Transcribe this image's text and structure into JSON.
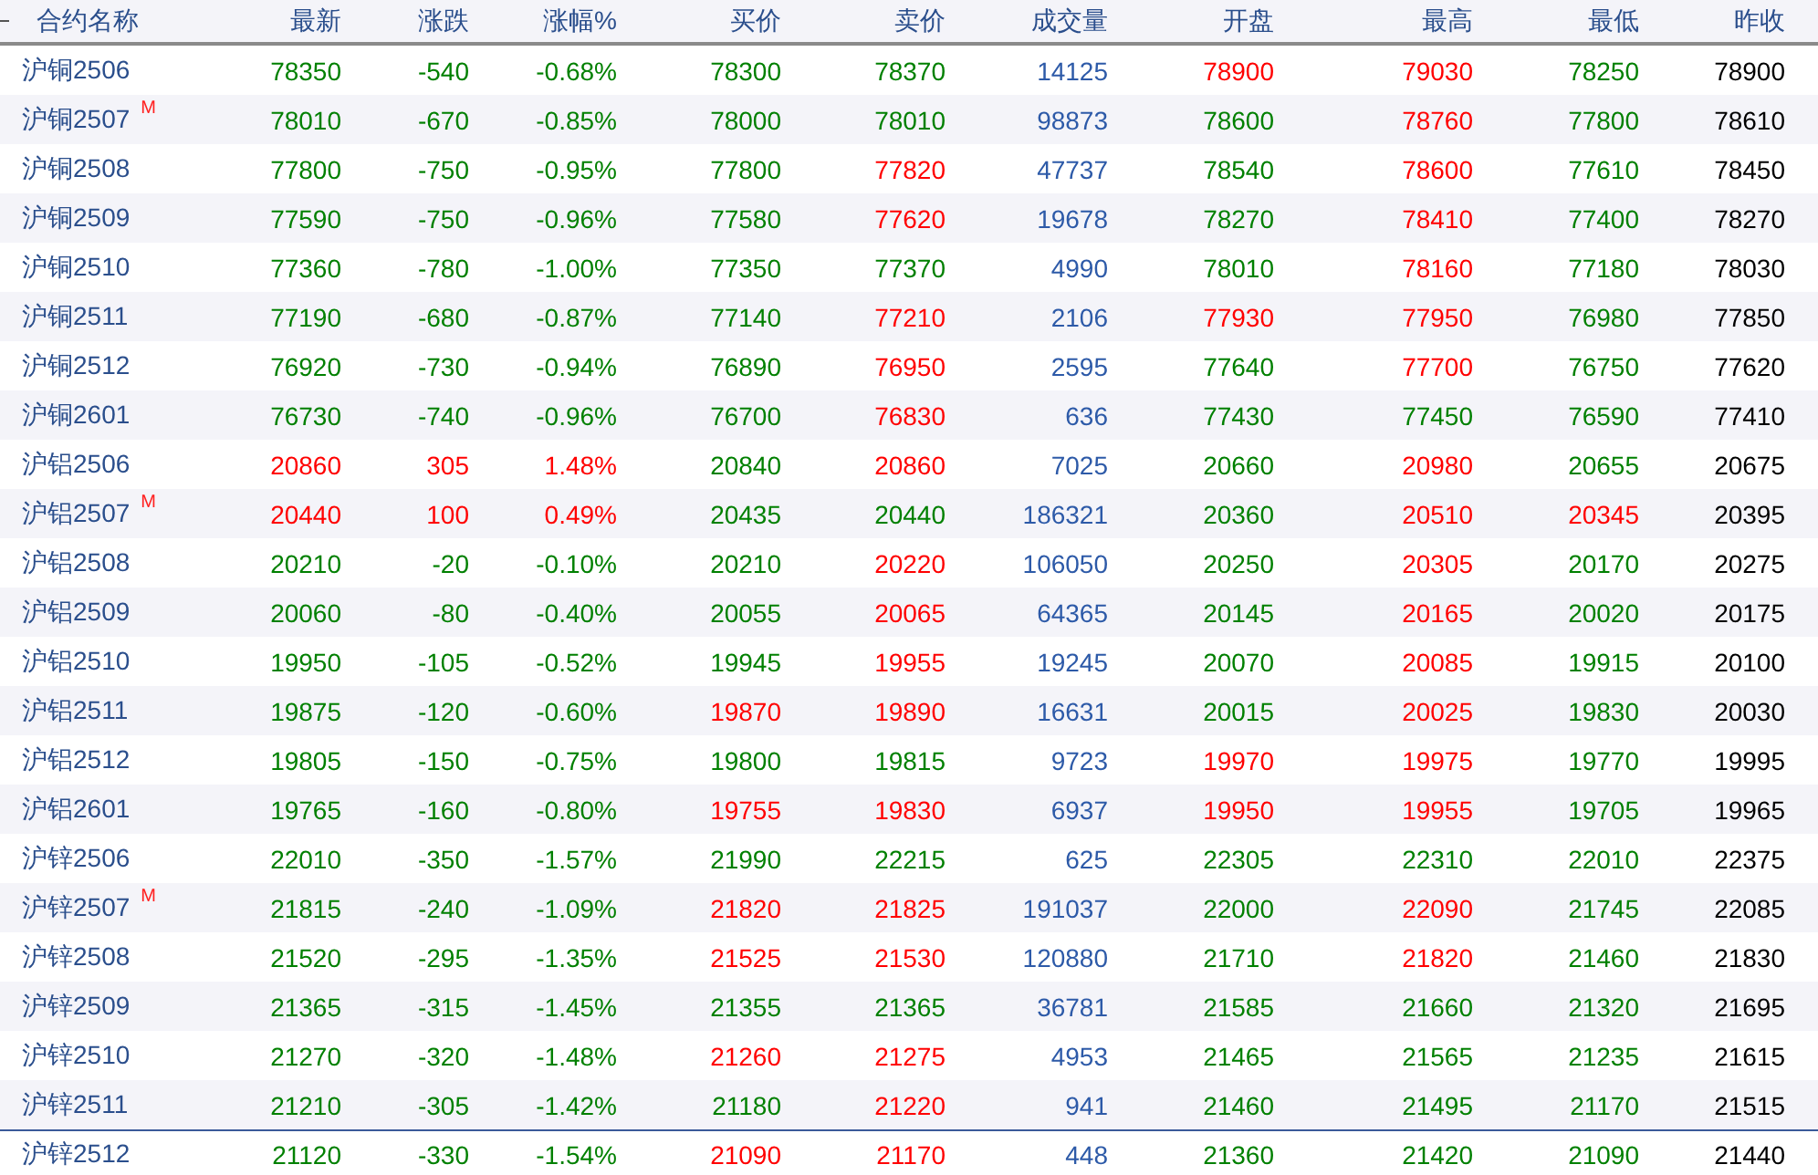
{
  "table": {
    "columns": [
      {
        "label": "合约名称",
        "kind": "name"
      },
      {
        "label": "最新",
        "kind": "value"
      },
      {
        "label": "涨跌",
        "kind": "value"
      },
      {
        "label": "涨幅%",
        "kind": "value"
      },
      {
        "label": "买价",
        "kind": "value"
      },
      {
        "label": "卖价",
        "kind": "value"
      },
      {
        "label": "成交量",
        "kind": "value"
      },
      {
        "label": "开盘",
        "kind": "value"
      },
      {
        "label": "最高",
        "kind": "value"
      },
      {
        "label": "最低",
        "kind": "value"
      },
      {
        "label": "昨收",
        "kind": "value"
      }
    ],
    "rows": [
      {
        "selected": false,
        "cells": [
          {
            "text": "沪铜2506",
            "color": "#2a4e8c"
          },
          {
            "text": "78350",
            "color": "#008000"
          },
          {
            "text": "-540",
            "color": "#008000"
          },
          {
            "text": "-0.68%",
            "color": "#008000"
          },
          {
            "text": "78300",
            "color": "#008000"
          },
          {
            "text": "78370",
            "color": "#008000"
          },
          {
            "text": "14125",
            "color": "#2d5aa8"
          },
          {
            "text": "78900",
            "color": "#ff0000"
          },
          {
            "text": "79030",
            "color": "#ff0000"
          },
          {
            "text": "78250",
            "color": "#008000"
          },
          {
            "text": "78900",
            "color": "#000000"
          }
        ]
      },
      {
        "selected": false,
        "cells": [
          {
            "text": "沪铜2507",
            "badge": "M",
            "color": "#2a4e8c"
          },
          {
            "text": "78010",
            "color": "#008000"
          },
          {
            "text": "-670",
            "color": "#008000"
          },
          {
            "text": "-0.85%",
            "color": "#008000"
          },
          {
            "text": "78000",
            "color": "#008000"
          },
          {
            "text": "78010",
            "color": "#008000"
          },
          {
            "text": "98873",
            "color": "#2d5aa8"
          },
          {
            "text": "78600",
            "color": "#008000"
          },
          {
            "text": "78760",
            "color": "#ff0000"
          },
          {
            "text": "77800",
            "color": "#008000"
          },
          {
            "text": "78610",
            "color": "#000000"
          }
        ]
      },
      {
        "selected": false,
        "cells": [
          {
            "text": "沪铜2508",
            "color": "#2a4e8c"
          },
          {
            "text": "77800",
            "color": "#008000"
          },
          {
            "text": "-750",
            "color": "#008000"
          },
          {
            "text": "-0.95%",
            "color": "#008000"
          },
          {
            "text": "77800",
            "color": "#008000"
          },
          {
            "text": "77820",
            "color": "#ff0000"
          },
          {
            "text": "47737",
            "color": "#2d5aa8"
          },
          {
            "text": "78540",
            "color": "#008000"
          },
          {
            "text": "78600",
            "color": "#ff0000"
          },
          {
            "text": "77610",
            "color": "#008000"
          },
          {
            "text": "78450",
            "color": "#000000"
          }
        ]
      },
      {
        "selected": false,
        "cells": [
          {
            "text": "沪铜2509",
            "color": "#2a4e8c"
          },
          {
            "text": "77590",
            "color": "#008000"
          },
          {
            "text": "-750",
            "color": "#008000"
          },
          {
            "text": "-0.96%",
            "color": "#008000"
          },
          {
            "text": "77580",
            "color": "#008000"
          },
          {
            "text": "77620",
            "color": "#ff0000"
          },
          {
            "text": "19678",
            "color": "#2d5aa8"
          },
          {
            "text": "78270",
            "color": "#008000"
          },
          {
            "text": "78410",
            "color": "#ff0000"
          },
          {
            "text": "77400",
            "color": "#008000"
          },
          {
            "text": "78270",
            "color": "#000000"
          }
        ]
      },
      {
        "selected": false,
        "cells": [
          {
            "text": "沪铜2510",
            "color": "#2a4e8c"
          },
          {
            "text": "77360",
            "color": "#008000"
          },
          {
            "text": "-780",
            "color": "#008000"
          },
          {
            "text": "-1.00%",
            "color": "#008000"
          },
          {
            "text": "77350",
            "color": "#008000"
          },
          {
            "text": "77370",
            "color": "#008000"
          },
          {
            "text": "4990",
            "color": "#2d5aa8"
          },
          {
            "text": "78010",
            "color": "#008000"
          },
          {
            "text": "78160",
            "color": "#ff0000"
          },
          {
            "text": "77180",
            "color": "#008000"
          },
          {
            "text": "78030",
            "color": "#000000"
          }
        ]
      },
      {
        "selected": false,
        "cells": [
          {
            "text": "沪铜2511",
            "color": "#2a4e8c"
          },
          {
            "text": "77190",
            "color": "#008000"
          },
          {
            "text": "-680",
            "color": "#008000"
          },
          {
            "text": "-0.87%",
            "color": "#008000"
          },
          {
            "text": "77140",
            "color": "#008000"
          },
          {
            "text": "77210",
            "color": "#ff0000"
          },
          {
            "text": "2106",
            "color": "#2d5aa8"
          },
          {
            "text": "77930",
            "color": "#ff0000"
          },
          {
            "text": "77950",
            "color": "#ff0000"
          },
          {
            "text": "76980",
            "color": "#008000"
          },
          {
            "text": "77850",
            "color": "#000000"
          }
        ]
      },
      {
        "selected": false,
        "cells": [
          {
            "text": "沪铜2512",
            "color": "#2a4e8c"
          },
          {
            "text": "76920",
            "color": "#008000"
          },
          {
            "text": "-730",
            "color": "#008000"
          },
          {
            "text": "-0.94%",
            "color": "#008000"
          },
          {
            "text": "76890",
            "color": "#008000"
          },
          {
            "text": "76950",
            "color": "#ff0000"
          },
          {
            "text": "2595",
            "color": "#2d5aa8"
          },
          {
            "text": "77640",
            "color": "#008000"
          },
          {
            "text": "77700",
            "color": "#ff0000"
          },
          {
            "text": "76750",
            "color": "#008000"
          },
          {
            "text": "77620",
            "color": "#000000"
          }
        ]
      },
      {
        "selected": false,
        "cells": [
          {
            "text": "沪铜2601",
            "color": "#2a4e8c"
          },
          {
            "text": "76730",
            "color": "#008000"
          },
          {
            "text": "-740",
            "color": "#008000"
          },
          {
            "text": "-0.96%",
            "color": "#008000"
          },
          {
            "text": "76700",
            "color": "#008000"
          },
          {
            "text": "76830",
            "color": "#ff0000"
          },
          {
            "text": "636",
            "color": "#2d5aa8"
          },
          {
            "text": "77430",
            "color": "#008000"
          },
          {
            "text": "77450",
            "color": "#008000"
          },
          {
            "text": "76590",
            "color": "#008000"
          },
          {
            "text": "77410",
            "color": "#000000"
          }
        ]
      },
      {
        "selected": false,
        "cells": [
          {
            "text": "沪铝2506",
            "color": "#2a4e8c"
          },
          {
            "text": "20860",
            "color": "#ff0000"
          },
          {
            "text": "305",
            "color": "#ff0000"
          },
          {
            "text": "1.48%",
            "color": "#ff0000"
          },
          {
            "text": "20840",
            "color": "#008000"
          },
          {
            "text": "20860",
            "color": "#ff0000"
          },
          {
            "text": "7025",
            "color": "#2d5aa8"
          },
          {
            "text": "20660",
            "color": "#008000"
          },
          {
            "text": "20980",
            "color": "#ff0000"
          },
          {
            "text": "20655",
            "color": "#008000"
          },
          {
            "text": "20675",
            "color": "#000000"
          }
        ]
      },
      {
        "selected": false,
        "cells": [
          {
            "text": "沪铝2507",
            "badge": "M",
            "color": "#2a4e8c"
          },
          {
            "text": "20440",
            "color": "#ff0000"
          },
          {
            "text": "100",
            "color": "#ff0000"
          },
          {
            "text": "0.49%",
            "color": "#ff0000"
          },
          {
            "text": "20435",
            "color": "#008000"
          },
          {
            "text": "20440",
            "color": "#008000"
          },
          {
            "text": "186321",
            "color": "#2d5aa8"
          },
          {
            "text": "20360",
            "color": "#008000"
          },
          {
            "text": "20510",
            "color": "#ff0000"
          },
          {
            "text": "20345",
            "color": "#ff0000"
          },
          {
            "text": "20395",
            "color": "#000000"
          }
        ]
      },
      {
        "selected": false,
        "cells": [
          {
            "text": "沪铝2508",
            "color": "#2a4e8c"
          },
          {
            "text": "20210",
            "color": "#008000"
          },
          {
            "text": "-20",
            "color": "#008000"
          },
          {
            "text": "-0.10%",
            "color": "#008000"
          },
          {
            "text": "20210",
            "color": "#008000"
          },
          {
            "text": "20220",
            "color": "#ff0000"
          },
          {
            "text": "106050",
            "color": "#2d5aa8"
          },
          {
            "text": "20250",
            "color": "#008000"
          },
          {
            "text": "20305",
            "color": "#ff0000"
          },
          {
            "text": "20170",
            "color": "#008000"
          },
          {
            "text": "20275",
            "color": "#000000"
          }
        ]
      },
      {
        "selected": false,
        "cells": [
          {
            "text": "沪铝2509",
            "color": "#2a4e8c"
          },
          {
            "text": "20060",
            "color": "#008000"
          },
          {
            "text": "-80",
            "color": "#008000"
          },
          {
            "text": "-0.40%",
            "color": "#008000"
          },
          {
            "text": "20055",
            "color": "#008000"
          },
          {
            "text": "20065",
            "color": "#ff0000"
          },
          {
            "text": "64365",
            "color": "#2d5aa8"
          },
          {
            "text": "20145",
            "color": "#008000"
          },
          {
            "text": "20165",
            "color": "#ff0000"
          },
          {
            "text": "20020",
            "color": "#008000"
          },
          {
            "text": "20175",
            "color": "#000000"
          }
        ]
      },
      {
        "selected": false,
        "cells": [
          {
            "text": "沪铝2510",
            "color": "#2a4e8c"
          },
          {
            "text": "19950",
            "color": "#008000"
          },
          {
            "text": "-105",
            "color": "#008000"
          },
          {
            "text": "-0.52%",
            "color": "#008000"
          },
          {
            "text": "19945",
            "color": "#008000"
          },
          {
            "text": "19955",
            "color": "#ff0000"
          },
          {
            "text": "19245",
            "color": "#2d5aa8"
          },
          {
            "text": "20070",
            "color": "#008000"
          },
          {
            "text": "20085",
            "color": "#ff0000"
          },
          {
            "text": "19915",
            "color": "#008000"
          },
          {
            "text": "20100",
            "color": "#000000"
          }
        ]
      },
      {
        "selected": false,
        "cells": [
          {
            "text": "沪铝2511",
            "color": "#2a4e8c"
          },
          {
            "text": "19875",
            "color": "#008000"
          },
          {
            "text": "-120",
            "color": "#008000"
          },
          {
            "text": "-0.60%",
            "color": "#008000"
          },
          {
            "text": "19870",
            "color": "#ff0000"
          },
          {
            "text": "19890",
            "color": "#ff0000"
          },
          {
            "text": "16631",
            "color": "#2d5aa8"
          },
          {
            "text": "20015",
            "color": "#008000"
          },
          {
            "text": "20025",
            "color": "#ff0000"
          },
          {
            "text": "19830",
            "color": "#008000"
          },
          {
            "text": "20030",
            "color": "#000000"
          }
        ]
      },
      {
        "selected": false,
        "cells": [
          {
            "text": "沪铝2512",
            "color": "#2a4e8c"
          },
          {
            "text": "19805",
            "color": "#008000"
          },
          {
            "text": "-150",
            "color": "#008000"
          },
          {
            "text": "-0.75%",
            "color": "#008000"
          },
          {
            "text": "19800",
            "color": "#008000"
          },
          {
            "text": "19815",
            "color": "#008000"
          },
          {
            "text": "9723",
            "color": "#2d5aa8"
          },
          {
            "text": "19970",
            "color": "#ff0000"
          },
          {
            "text": "19975",
            "color": "#ff0000"
          },
          {
            "text": "19770",
            "color": "#008000"
          },
          {
            "text": "19995",
            "color": "#000000"
          }
        ]
      },
      {
        "selected": false,
        "cells": [
          {
            "text": "沪铝2601",
            "color": "#2a4e8c"
          },
          {
            "text": "19765",
            "color": "#008000"
          },
          {
            "text": "-160",
            "color": "#008000"
          },
          {
            "text": "-0.80%",
            "color": "#008000"
          },
          {
            "text": "19755",
            "color": "#ff0000"
          },
          {
            "text": "19830",
            "color": "#ff0000"
          },
          {
            "text": "6937",
            "color": "#2d5aa8"
          },
          {
            "text": "19950",
            "color": "#ff0000"
          },
          {
            "text": "19955",
            "color": "#ff0000"
          },
          {
            "text": "19705",
            "color": "#008000"
          },
          {
            "text": "19965",
            "color": "#000000"
          }
        ]
      },
      {
        "selected": false,
        "cells": [
          {
            "text": "沪锌2506",
            "color": "#2a4e8c"
          },
          {
            "text": "22010",
            "color": "#008000"
          },
          {
            "text": "-350",
            "color": "#008000"
          },
          {
            "text": "-1.57%",
            "color": "#008000"
          },
          {
            "text": "21990",
            "color": "#008000"
          },
          {
            "text": "22215",
            "color": "#008000"
          },
          {
            "text": "625",
            "color": "#2d5aa8"
          },
          {
            "text": "22305",
            "color": "#008000"
          },
          {
            "text": "22310",
            "color": "#008000"
          },
          {
            "text": "22010",
            "color": "#008000"
          },
          {
            "text": "22375",
            "color": "#000000"
          }
        ]
      },
      {
        "selected": false,
        "cells": [
          {
            "text": "沪锌2507",
            "badge": "M",
            "color": "#2a4e8c"
          },
          {
            "text": "21815",
            "color": "#008000"
          },
          {
            "text": "-240",
            "color": "#008000"
          },
          {
            "text": "-1.09%",
            "color": "#008000"
          },
          {
            "text": "21820",
            "color": "#ff0000"
          },
          {
            "text": "21825",
            "color": "#ff0000"
          },
          {
            "text": "191037",
            "color": "#2d5aa8"
          },
          {
            "text": "22000",
            "color": "#008000"
          },
          {
            "text": "22090",
            "color": "#ff0000"
          },
          {
            "text": "21745",
            "color": "#008000"
          },
          {
            "text": "22085",
            "color": "#000000"
          }
        ]
      },
      {
        "selected": false,
        "cells": [
          {
            "text": "沪锌2508",
            "color": "#2a4e8c"
          },
          {
            "text": "21520",
            "color": "#008000"
          },
          {
            "text": "-295",
            "color": "#008000"
          },
          {
            "text": "-1.35%",
            "color": "#008000"
          },
          {
            "text": "21525",
            "color": "#ff0000"
          },
          {
            "text": "21530",
            "color": "#ff0000"
          },
          {
            "text": "120880",
            "color": "#2d5aa8"
          },
          {
            "text": "21710",
            "color": "#008000"
          },
          {
            "text": "21820",
            "color": "#ff0000"
          },
          {
            "text": "21460",
            "color": "#008000"
          },
          {
            "text": "21830",
            "color": "#000000"
          }
        ]
      },
      {
        "selected": false,
        "cells": [
          {
            "text": "沪锌2509",
            "color": "#2a4e8c"
          },
          {
            "text": "21365",
            "color": "#008000"
          },
          {
            "text": "-315",
            "color": "#008000"
          },
          {
            "text": "-1.45%",
            "color": "#008000"
          },
          {
            "text": "21355",
            "color": "#008000"
          },
          {
            "text": "21365",
            "color": "#008000"
          },
          {
            "text": "36781",
            "color": "#2d5aa8"
          },
          {
            "text": "21585",
            "color": "#008000"
          },
          {
            "text": "21660",
            "color": "#008000"
          },
          {
            "text": "21320",
            "color": "#008000"
          },
          {
            "text": "21695",
            "color": "#000000"
          }
        ]
      },
      {
        "selected": false,
        "cells": [
          {
            "text": "沪锌2510",
            "color": "#2a4e8c"
          },
          {
            "text": "21270",
            "color": "#008000"
          },
          {
            "text": "-320",
            "color": "#008000"
          },
          {
            "text": "-1.48%",
            "color": "#008000"
          },
          {
            "text": "21260",
            "color": "#ff0000"
          },
          {
            "text": "21275",
            "color": "#ff0000"
          },
          {
            "text": "4953",
            "color": "#2d5aa8"
          },
          {
            "text": "21465",
            "color": "#008000"
          },
          {
            "text": "21565",
            "color": "#008000"
          },
          {
            "text": "21235",
            "color": "#008000"
          },
          {
            "text": "21615",
            "color": "#000000"
          }
        ]
      },
      {
        "selected": false,
        "cells": [
          {
            "text": "沪锌2511",
            "color": "#2a4e8c"
          },
          {
            "text": "21210",
            "color": "#008000"
          },
          {
            "text": "-305",
            "color": "#008000"
          },
          {
            "text": "-1.42%",
            "color": "#008000"
          },
          {
            "text": "21180",
            "color": "#008000"
          },
          {
            "text": "21220",
            "color": "#ff0000"
          },
          {
            "text": "941",
            "color": "#2d5aa8"
          },
          {
            "text": "21460",
            "color": "#008000"
          },
          {
            "text": "21495",
            "color": "#008000"
          },
          {
            "text": "21170",
            "color": "#008000"
          },
          {
            "text": "21515",
            "color": "#000000"
          }
        ]
      },
      {
        "selected": true,
        "cells": [
          {
            "text": "沪锌2512",
            "color": "#2a4e8c"
          },
          {
            "text": "21120",
            "color": "#008000"
          },
          {
            "text": "-330",
            "color": "#008000"
          },
          {
            "text": "-1.54%",
            "color": "#008000"
          },
          {
            "text": "21090",
            "color": "#ff0000"
          },
          {
            "text": "21170",
            "color": "#ff0000"
          },
          {
            "text": "448",
            "color": "#2d5aa8"
          },
          {
            "text": "21360",
            "color": "#008000"
          },
          {
            "text": "21420",
            "color": "#008000"
          },
          {
            "text": "21090",
            "color": "#008000"
          },
          {
            "text": "21440",
            "color": "#000000"
          }
        ]
      }
    ]
  }
}
